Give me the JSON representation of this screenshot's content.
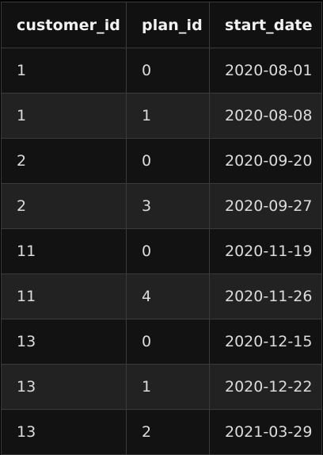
{
  "table": {
    "columns": [
      "customer_id",
      "plan_id",
      "start_date"
    ],
    "rows": [
      [
        "1",
        "0",
        "2020-08-01"
      ],
      [
        "1",
        "1",
        "2020-08-08"
      ],
      [
        "2",
        "0",
        "2020-09-20"
      ],
      [
        "2",
        "3",
        "2020-09-27"
      ],
      [
        "11",
        "0",
        "2020-11-19"
      ],
      [
        "11",
        "4",
        "2020-11-26"
      ],
      [
        "13",
        "0",
        "2020-12-15"
      ],
      [
        "13",
        "1",
        "2020-12-22"
      ],
      [
        "13",
        "2",
        "2021-03-29"
      ]
    ]
  }
}
